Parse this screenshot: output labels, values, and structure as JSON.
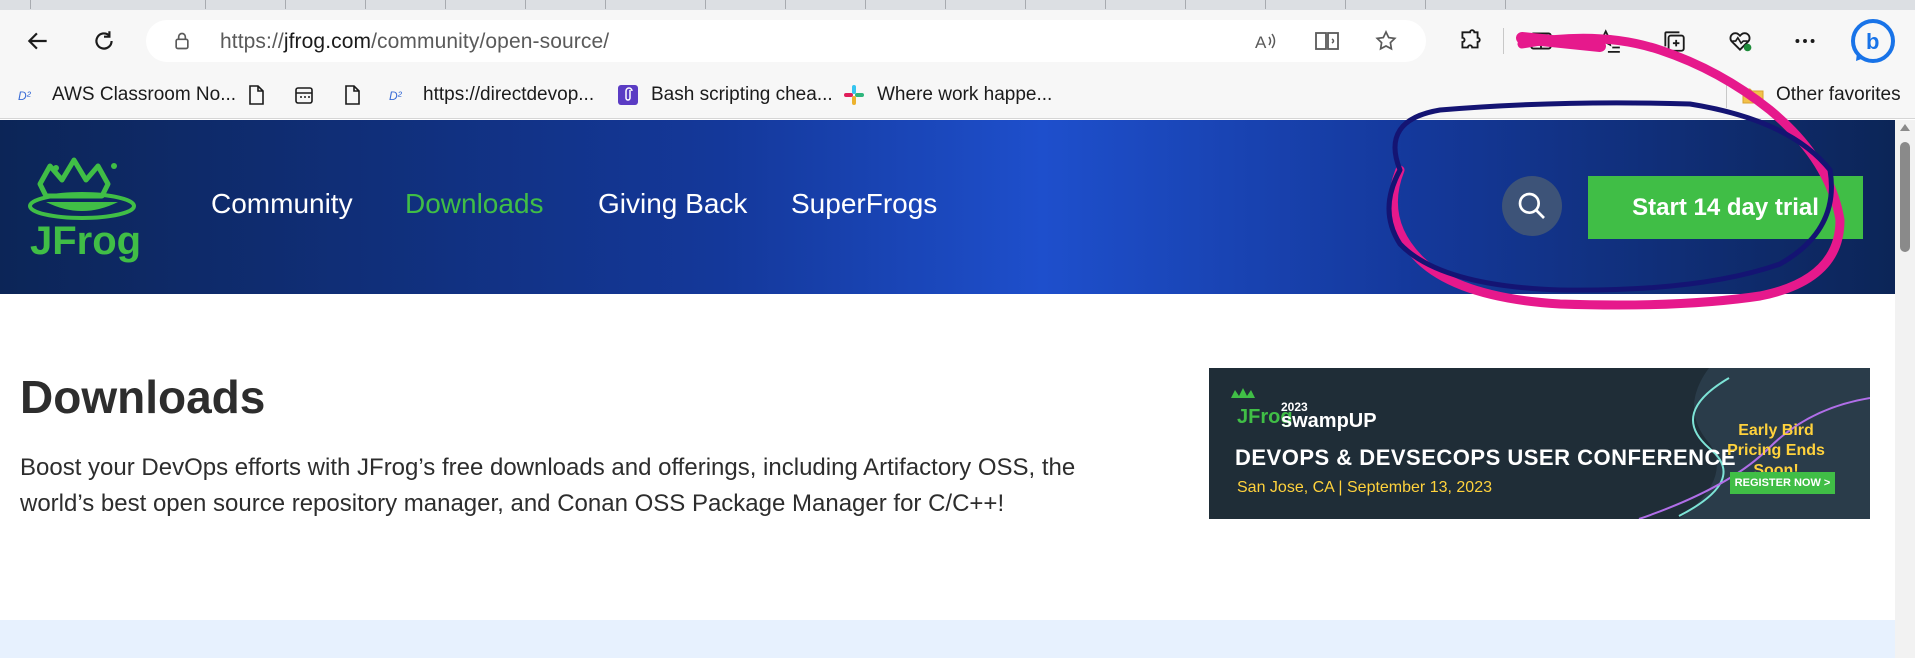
{
  "browser": {
    "url": {
      "scheme": "https://",
      "host": "jfrog.com",
      "path": "/community/open-source/"
    },
    "bookmarks": [
      {
        "label": "AWS Classroom No...",
        "icon": "d2-icon"
      },
      {
        "label": "",
        "icon": "document-icon"
      },
      {
        "label": "",
        "icon": "calendar-icon"
      },
      {
        "label": "",
        "icon": "document-icon"
      },
      {
        "label": "https://directdevop...",
        "icon": "d2-icon"
      },
      {
        "label": "Bash scripting chea...",
        "icon": "paperclip-icon"
      },
      {
        "label": "Where work happe...",
        "icon": "slack-icon"
      },
      {
        "label": "Other favorites",
        "icon": "folder-icon"
      }
    ]
  },
  "site": {
    "logo_text": "JFrog",
    "nav": [
      {
        "label": "Community",
        "active": false
      },
      {
        "label": "Downloads",
        "active": true
      },
      {
        "label": "Giving Back",
        "active": false
      },
      {
        "label": "SuperFrogs",
        "active": false
      }
    ],
    "trial_button": "Start 14 day trial"
  },
  "main": {
    "title": "Downloads",
    "description": "Boost your DevOps efforts with JFrog’s free downloads and offerings, including Artifactory OSS, the world’s best open source repository manager, and Conan OSS Package Manager for C/C++!"
  },
  "banner": {
    "brand": "JFrog",
    "year": "2023",
    "event": "swampUP",
    "headline": "DEVOPS & DEVSECOPS USER CONFERENCE",
    "sub": "San Jose, CA | September 13, 2023",
    "promo": "Early Bird Pricing Ends Soon!",
    "cta": "REGISTER NOW >"
  },
  "colors": {
    "accent_green": "#40be46",
    "header_dark": "#0c2557",
    "header_mid": "#1e4fcc",
    "annotation_pink": "#e6198c",
    "annotation_navy": "#141473"
  }
}
